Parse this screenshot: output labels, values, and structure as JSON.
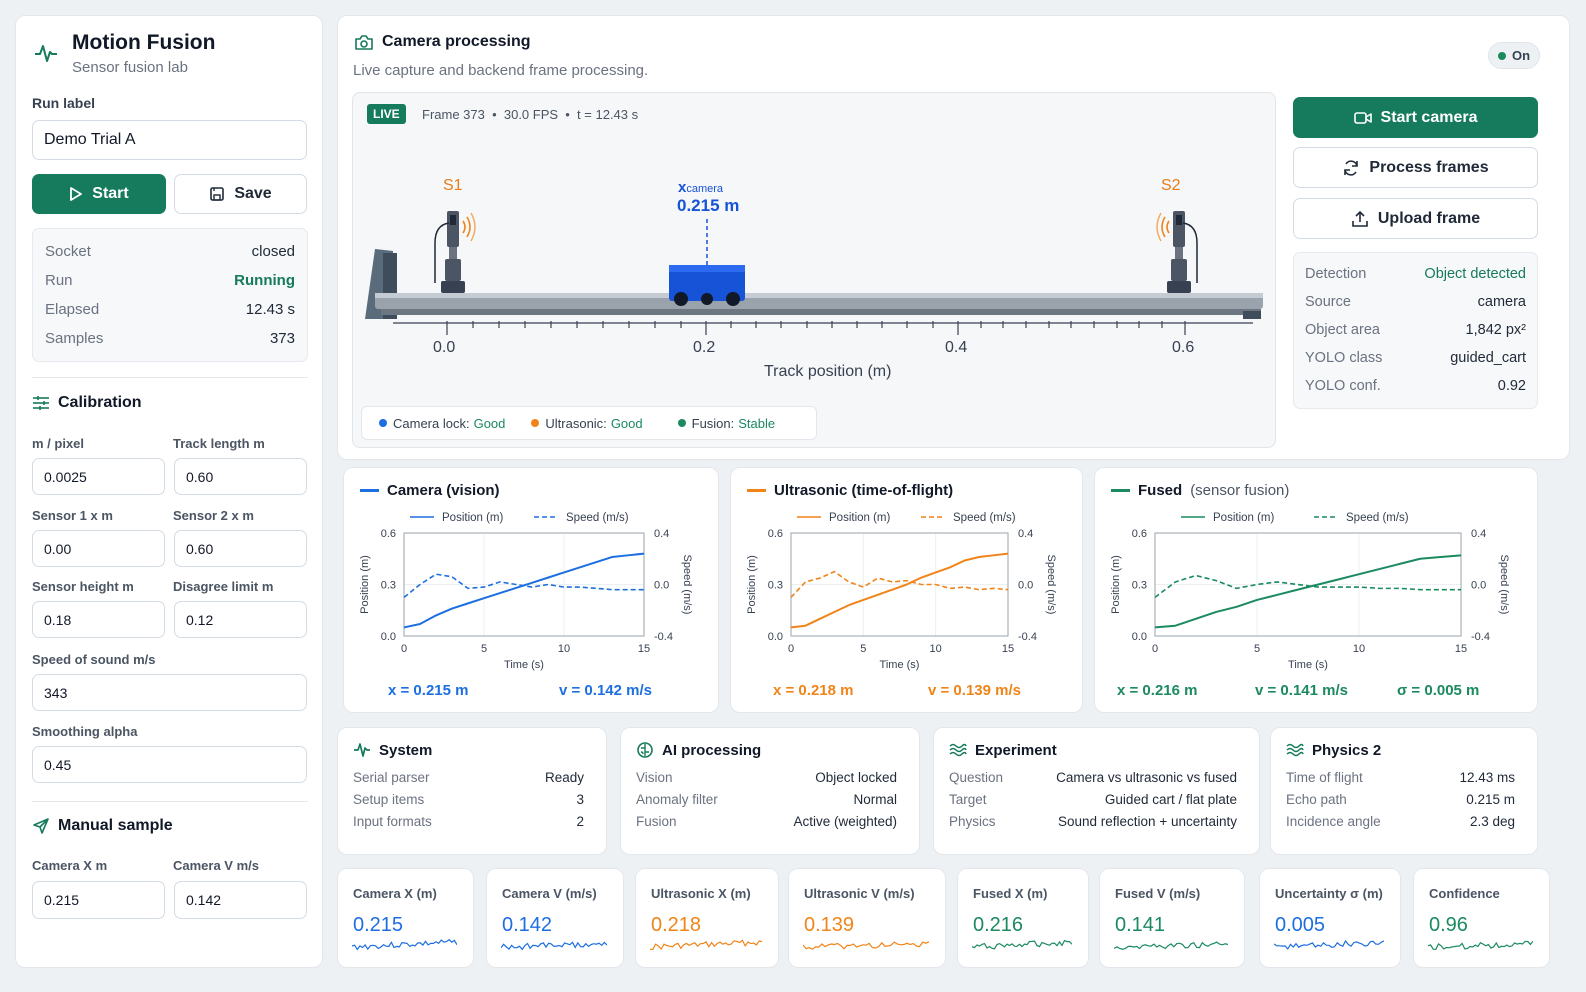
{
  "app": {
    "title": "Motion Fusion",
    "subtitle": "Sensor fusion lab"
  },
  "colors": {
    "camera": "#1d6fe0",
    "ultrasonic": "#f08419",
    "fused": "#1b8a5f",
    "accent": "#167a5c"
  },
  "sidebar": {
    "run_label_title": "Run label",
    "run_label_value": "Demo Trial A",
    "start_label": "Start",
    "save_label": "Save",
    "status": [
      {
        "key": "Socket",
        "value": "closed"
      },
      {
        "key": "Run",
        "value": "Running"
      },
      {
        "key": "Elapsed",
        "value": "12.43 s"
      },
      {
        "key": "Samples",
        "value": "373"
      }
    ],
    "calibration_title": "Calibration",
    "fields": [
      {
        "label": "m / pixel",
        "value": "0.0025"
      },
      {
        "label": "Track length m",
        "value": "0.60"
      },
      {
        "label": "Sensor 1 x m",
        "value": "0.00"
      },
      {
        "label": "Sensor 2 x m",
        "value": "0.60"
      },
      {
        "label": "Sensor height m",
        "value": "0.18"
      },
      {
        "label": "Disagree limit m",
        "value": "0.12"
      },
      {
        "label": "Speed of sound m/s",
        "value": "343"
      },
      {
        "label": "Smoothing alpha",
        "value": "0.45"
      }
    ],
    "manual_title": "Manual sample",
    "manual_fields": [
      {
        "label": "Camera X m",
        "value": "0.215"
      },
      {
        "label": "Camera V m/s",
        "value": "0.142"
      }
    ]
  },
  "camera": {
    "title": "Camera processing",
    "subtitle": "Live capture and backend frame processing.",
    "toggle": "On",
    "live_badge": "LIVE",
    "frame_info": "Frame 373  •  30.0 FPS  •  t = 12.43 s",
    "s1": "S1",
    "s2": "S2",
    "xcam_label": "x",
    "xcam_sub": "camera",
    "xcam_value": "0.215 m",
    "ticks": [
      "0.0",
      "0.2",
      "0.4",
      "0.6"
    ],
    "axis_label": "Track position (m)",
    "status": [
      {
        "key": "Camera lock:",
        "value": "Good",
        "color": "#1d6fe0"
      },
      {
        "key": "Ultrasonic:",
        "value": "Good",
        "color": "#f08419"
      },
      {
        "key": "Fusion:",
        "value": "Stable",
        "color": "#1b8a5f"
      }
    ],
    "start_camera": "Start camera",
    "process_frames": "Process frames",
    "upload_frame": "Upload frame",
    "detection": [
      {
        "key": "Detection",
        "value": "Object detected"
      },
      {
        "key": "Source",
        "value": "camera"
      },
      {
        "key": "Object area",
        "value": "1,842 px²"
      },
      {
        "key": "YOLO class",
        "value": "guided_cart"
      },
      {
        "key": "YOLO conf.",
        "value": "0.92"
      }
    ]
  },
  "charts": [
    {
      "title": "Camera (vision)",
      "title_extra": "",
      "legend_pos": "Position (m)",
      "legend_speed": "Speed (m/s)",
      "y_label": "Position (m)",
      "y2_label": "Speed (m/s)",
      "x_label": "Time (s)",
      "readouts": [
        "x = 0.215 m",
        "v = 0.142 m/s"
      ]
    },
    {
      "title": "Ultrasonic (time-of-flight)",
      "title_extra": "",
      "legend_pos": "Position (m)",
      "legend_speed": "Speed (m/s)",
      "y_label": "Position (m)",
      "y2_label": "Speed (m/s)",
      "x_label": "Time (s)",
      "readouts": [
        "x = 0.218 m",
        "v = 0.139 m/s"
      ]
    },
    {
      "title": "Fused",
      "title_extra": "(sensor fusion)",
      "legend_pos": "Position (m)",
      "legend_speed": "Speed (m/s)",
      "y_label": "Position (m)",
      "y2_label": "Speed (m/s)",
      "x_label": "Time (s)",
      "readouts": [
        "x = 0.216 m",
        "v = 0.141 m/s",
        "σ = 0.005 m"
      ]
    }
  ],
  "chart_data": [
    {
      "type": "line",
      "xlim": [
        0,
        15
      ],
      "ylim": [
        0,
        0.6
      ],
      "y2lim": [
        -0.4,
        0.4
      ],
      "xticks": [
        "0",
        "5",
        "10",
        "15"
      ],
      "yticks": [
        "0.0",
        "0.3",
        "0.6"
      ],
      "y2ticks": [
        "-0.4",
        "0.0",
        "0.4"
      ],
      "series": [
        {
          "name": "Position (m)",
          "x": [
            0,
            1,
            2,
            3,
            4,
            5,
            6,
            7,
            8,
            9,
            10,
            11,
            12,
            13,
            14,
            15
          ],
          "y": [
            0.05,
            0.07,
            0.12,
            0.16,
            0.19,
            0.22,
            0.25,
            0.28,
            0.31,
            0.34,
            0.37,
            0.4,
            0.43,
            0.46,
            0.47,
            0.48
          ]
        },
        {
          "name": "Speed (m/s)",
          "x": [
            0,
            1,
            2,
            3,
            4,
            5,
            6,
            7,
            8,
            9,
            10,
            11,
            12,
            13,
            14,
            15
          ],
          "y": [
            -0.1,
            0.0,
            0.08,
            0.06,
            -0.03,
            -0.02,
            0.02,
            0.0,
            -0.02,
            0.0,
            -0.02,
            -0.02,
            -0.03,
            -0.04,
            -0.04,
            -0.04
          ]
        }
      ]
    },
    {
      "type": "line",
      "xlim": [
        0,
        15
      ],
      "ylim": [
        0,
        0.6
      ],
      "y2lim": [
        -0.4,
        0.4
      ],
      "xticks": [
        "0",
        "5",
        "10",
        "15"
      ],
      "yticks": [
        "0.0",
        "0.3",
        "0.6"
      ],
      "y2ticks": [
        "-0.4",
        "0.0",
        "0.4"
      ],
      "series": [
        {
          "name": "Position (m)",
          "x": [
            0,
            1,
            2,
            3,
            4,
            5,
            6,
            7,
            8,
            9,
            10,
            11,
            12,
            13,
            14,
            15
          ],
          "y": [
            0.05,
            0.06,
            0.1,
            0.14,
            0.18,
            0.21,
            0.24,
            0.27,
            0.3,
            0.34,
            0.37,
            0.4,
            0.44,
            0.46,
            0.47,
            0.48
          ]
        },
        {
          "name": "Speed (m/s)",
          "x": [
            0,
            1,
            2,
            3,
            4,
            5,
            6,
            7,
            8,
            9,
            10,
            11,
            12,
            13,
            14,
            15
          ],
          "y": [
            -0.1,
            0.02,
            0.05,
            0.1,
            0.02,
            -0.02,
            0.05,
            0.02,
            0.03,
            0.0,
            0.0,
            -0.03,
            -0.02,
            -0.04,
            -0.03,
            -0.04
          ]
        }
      ]
    },
    {
      "type": "line",
      "xlim": [
        0,
        15
      ],
      "ylim": [
        0,
        0.6
      ],
      "y2lim": [
        -0.4,
        0.4
      ],
      "xticks": [
        "0",
        "5",
        "10",
        "15"
      ],
      "yticks": [
        "0.0",
        "0.3",
        "0.6"
      ],
      "y2ticks": [
        "-0.4",
        "0.0",
        "0.4"
      ],
      "series": [
        {
          "name": "Position (m)",
          "x": [
            0,
            1,
            2,
            3,
            4,
            5,
            6,
            7,
            8,
            9,
            10,
            11,
            12,
            13,
            14,
            15
          ],
          "y": [
            0.05,
            0.06,
            0.1,
            0.14,
            0.17,
            0.21,
            0.24,
            0.27,
            0.3,
            0.33,
            0.36,
            0.39,
            0.42,
            0.45,
            0.46,
            0.47
          ]
        },
        {
          "name": "Speed (m/s)",
          "x": [
            0,
            1,
            2,
            3,
            4,
            5,
            6,
            7,
            8,
            9,
            10,
            11,
            12,
            13,
            14,
            15
          ],
          "y": [
            -0.1,
            0.02,
            0.07,
            0.03,
            -0.03,
            0.0,
            0.02,
            0.0,
            -0.02,
            -0.02,
            -0.02,
            -0.03,
            -0.03,
            -0.04,
            -0.04,
            -0.04
          ]
        }
      ]
    }
  ],
  "info_cards": [
    {
      "title": "System",
      "icon": "pulse-icon",
      "rows": [
        {
          "k": "Serial parser",
          "v": "Ready"
        },
        {
          "k": "Setup items",
          "v": "3"
        },
        {
          "k": "Input formats",
          "v": "2"
        }
      ]
    },
    {
      "title": "AI processing",
      "icon": "brain-icon",
      "rows": [
        {
          "k": "Vision",
          "v": "Object locked"
        },
        {
          "k": "Anomaly filter",
          "v": "Normal"
        },
        {
          "k": "Fusion",
          "v": "Active (weighted)"
        }
      ]
    },
    {
      "title": "Experiment",
      "icon": "wave-icon",
      "rows": [
        {
          "k": "Question",
          "v": "Camera vs ultrasonic vs fused"
        },
        {
          "k": "Target",
          "v": "Guided cart / flat plate"
        },
        {
          "k": "Physics",
          "v": "Sound reflection + uncertainty"
        }
      ]
    },
    {
      "title": "Physics 2",
      "icon": "wave-icon",
      "rows": [
        {
          "k": "Time of flight",
          "v": "12.43 ms"
        },
        {
          "k": "Echo path",
          "v": "0.215 m"
        },
        {
          "k": "Incidence angle",
          "v": "2.3 deg"
        }
      ]
    }
  ],
  "stats": [
    {
      "label": "Camera X (m)",
      "value": "0.215",
      "color": "#1d6fe0"
    },
    {
      "label": "Camera V (m/s)",
      "value": "0.142",
      "color": "#1d6fe0"
    },
    {
      "label": "Ultrasonic X (m)",
      "value": "0.218",
      "color": "#f08419"
    },
    {
      "label": "Ultrasonic V (m/s)",
      "value": "0.139",
      "color": "#f08419"
    },
    {
      "label": "Fused X (m)",
      "value": "0.216",
      "color": "#1b8a5f"
    },
    {
      "label": "Fused V (m/s)",
      "value": "0.141",
      "color": "#1b8a5f"
    },
    {
      "label": "Uncertainty σ (m)",
      "value": "0.005",
      "color": "#1d6fe0"
    },
    {
      "label": "Confidence",
      "value": "0.96",
      "color": "#1b8a5f"
    }
  ]
}
